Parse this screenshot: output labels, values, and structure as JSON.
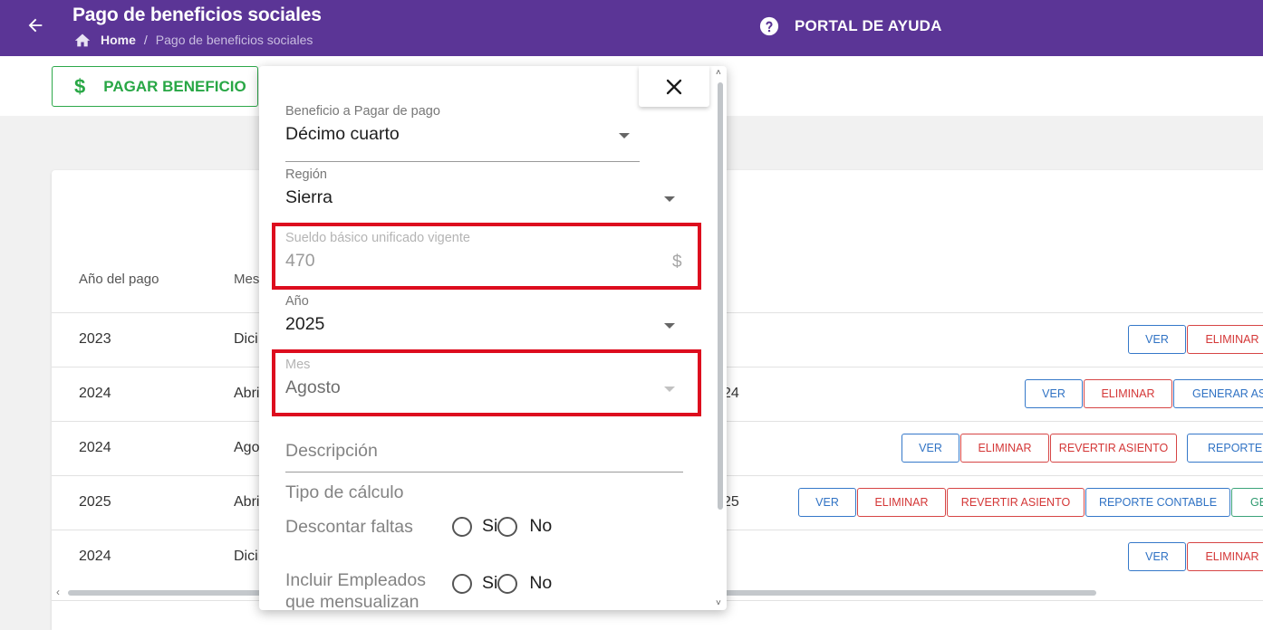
{
  "header": {
    "title": "Pago de beneficios sociales",
    "breadcrumb_home": "Home",
    "breadcrumb_separator": "/",
    "breadcrumb_current": "Pago de beneficios sociales",
    "help_label": "PORTAL DE AYUDA",
    "colors": {
      "bar": "#5b3596"
    }
  },
  "toolbar": {
    "pay_symbol": "$",
    "pay_label": "PAGAR BENEFICIO",
    "colors": {
      "pay": "#28a745"
    }
  },
  "table": {
    "headers": [
      "Año del pago",
      "Mes"
    ],
    "rows": [
      {
        "year": "2023",
        "month": "Dici",
        "extra": "",
        "buttons": [
          "VER",
          "ELIMINAR"
        ]
      },
      {
        "year": "2024",
        "month": "Abri",
        "extra": "24",
        "buttons": [
          "VER",
          "ELIMINAR",
          "GENERAR ASI"
        ]
      },
      {
        "year": "2024",
        "month": "Ago",
        "extra": "",
        "buttons": [
          "VER",
          "ELIMINAR",
          "REVERTIR ASIENTO",
          "REPORTE C"
        ]
      },
      {
        "year": "2025",
        "month": "Abri",
        "extra": "25",
        "buttons": [
          "VER",
          "ELIMINAR",
          "REVERTIR ASIENTO",
          "REPORTE CONTABLE",
          "GE"
        ]
      },
      {
        "year": "2024",
        "month": "Dici",
        "extra": "",
        "buttons": [
          "VER",
          "ELIMINAR"
        ]
      }
    ],
    "scroll_left_arrow": "‹"
  },
  "dialog": {
    "close_icon": "close-icon",
    "scroll_up": "˄",
    "scroll_down": "˅",
    "fields": {
      "beneficio": {
        "label": "Beneficio a Pagar de pago",
        "value": "Décimo cuarto"
      },
      "region": {
        "label": "Región",
        "value": "Sierra"
      },
      "sueldo": {
        "label": "Sueldo básico unificado vigente",
        "value": "470",
        "suffix": "$"
      },
      "anio": {
        "label": "Año",
        "value": "2025"
      },
      "mes": {
        "label": "Mes",
        "value": "Agosto"
      }
    },
    "descripcion_placeholder": "Descripción",
    "tipo_calculo_label": "Tipo de cálculo",
    "descontar_faltas": {
      "label": "Descontar faltas",
      "yes": "Si",
      "no": "No"
    },
    "incluir_empleados": {
      "label_line1": "Incluir Empleados",
      "label_line2": "que mensualizan",
      "yes": "Si",
      "no": "No"
    },
    "highlight_color": "#dd0d1e"
  }
}
